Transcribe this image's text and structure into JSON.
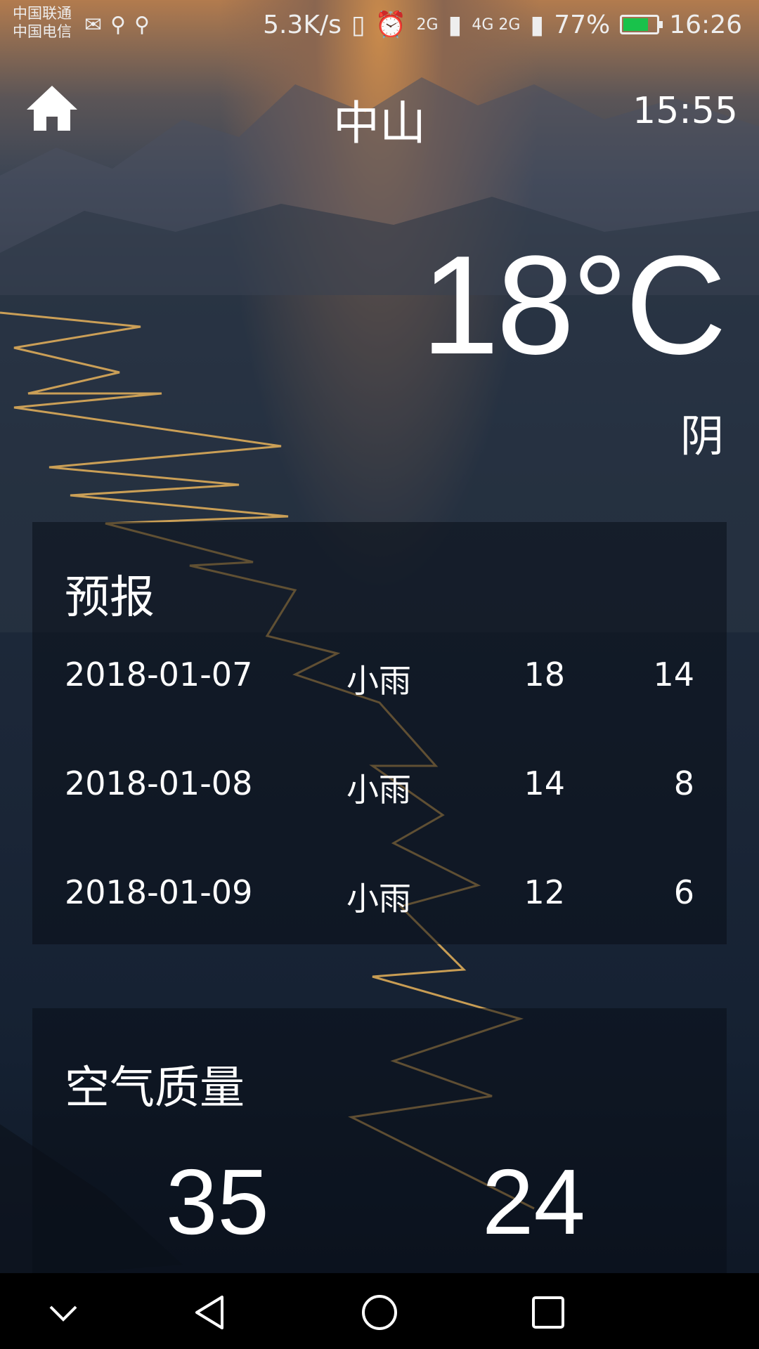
{
  "status_bar": {
    "carrier_1": "中国联通",
    "carrier_2": "中国电信",
    "net_speed": "5.3K/s",
    "sim1_type": "2G",
    "sim2_type": "4G 2G",
    "battery": "77%",
    "battery_level": 0.77,
    "battery_color": "#19c24b",
    "clock": "16:26",
    "icons": [
      "mail-icon",
      "usb-icon",
      "usb-icon",
      "vibrate-icon",
      "alarm-icon",
      "signal-icon",
      "signal-icon",
      "battery-icon"
    ]
  },
  "header": {
    "home_icon": "home-icon",
    "city": "中山",
    "update_time": "15:55"
  },
  "now": {
    "degree": "18°C",
    "info": "阴"
  },
  "forecast": {
    "title": "预报",
    "items": [
      {
        "date": "2018-01-07",
        "info": "小雨",
        "max": "18",
        "min": "14"
      },
      {
        "date": "2018-01-08",
        "info": "小雨",
        "max": "14",
        "min": "8"
      },
      {
        "date": "2018-01-09",
        "info": "小雨",
        "max": "12",
        "min": "6"
      }
    ]
  },
  "aqi": {
    "title": "空气质量",
    "aqi_value": "35",
    "pm25_value": "24"
  },
  "nav_bar": {
    "icons": [
      "collapse-chevron-icon",
      "back-triangle-icon",
      "home-circle-icon",
      "recents-square-icon"
    ]
  }
}
